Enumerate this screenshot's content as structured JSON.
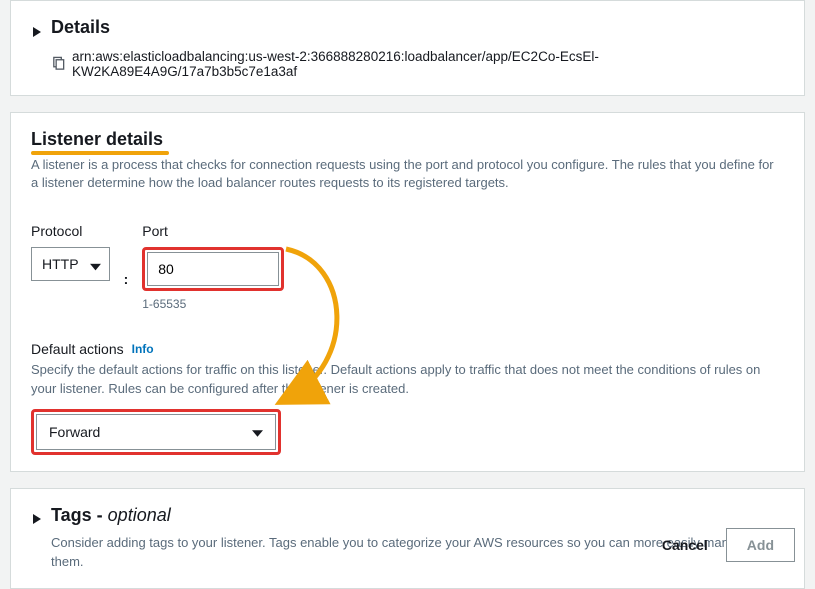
{
  "details": {
    "title": "Details",
    "arn": "arn:aws:elasticloadbalancing:us-west-2:366888280216:loadbalancer/app/EC2Co-EcsEl-KW2KA89E4A9G/17a7b3b5c7e1a3af"
  },
  "listener": {
    "title": "Listener details",
    "description": "A listener is a process that checks for connection requests using the port and protocol you configure. The rules that you define for a listener determine how the load balancer routes requests to its registered targets.",
    "protocol": {
      "label": "Protocol",
      "value": "HTTP"
    },
    "port": {
      "label": "Port",
      "value": "80",
      "range": "1-65535"
    },
    "defaultActions": {
      "label": "Default actions",
      "info": "Info",
      "help": "Specify the default actions for traffic on this listener. Default actions apply to traffic that does not meet the conditions of rules on your listener. Rules can be configured after the listener is created.",
      "selected": "Forward"
    }
  },
  "tags": {
    "title_prefix": "Tags - ",
    "title_suffix": "optional",
    "help": "Consider adding tags to your listener. Tags enable you to categorize your AWS resources so you can more easily manage them."
  },
  "footer": {
    "cancel": "Cancel",
    "add": "Add"
  }
}
